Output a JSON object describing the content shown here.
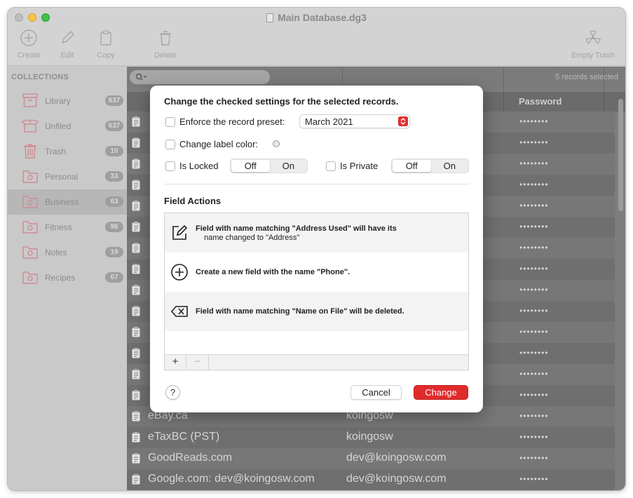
{
  "window": {
    "title": "Main Database.dg3"
  },
  "toolbar": {
    "create": "Create",
    "edit": "Edit",
    "copy": "Copy",
    "delete": "Delete",
    "empty_trash": "Empty Trash"
  },
  "sidebar": {
    "heading": "COLLECTIONS",
    "items": [
      {
        "label": "Library",
        "count": "637",
        "icon": "archive-box-icon"
      },
      {
        "label": "Unfiled",
        "count": "637",
        "icon": "open-box-icon"
      },
      {
        "label": "Trash",
        "count": "10",
        "icon": "trash-icon"
      },
      {
        "label": "Personal",
        "count": "33",
        "icon": "folder-gear-icon"
      },
      {
        "label": "Business",
        "count": "63",
        "icon": "folder-gear-icon"
      },
      {
        "label": "Fitness",
        "count": "96",
        "icon": "folder-gear-icon"
      },
      {
        "label": "Notes",
        "count": "19",
        "icon": "folder-gear-icon"
      },
      {
        "label": "Recipes",
        "count": "67",
        "icon": "folder-gear-icon"
      }
    ]
  },
  "list": {
    "search_placeholder": "",
    "selection_status": "5 records selected",
    "password_header": "Password",
    "rows": [
      {
        "name": "eBay.ca",
        "user": "koingosw"
      },
      {
        "name": "eTaxBC (PST)",
        "user": "koingosw"
      },
      {
        "name": "GoodReads.com",
        "user": "dev@koingosw.com"
      },
      {
        "name": "Google.com: dev@koingosw.com",
        "user": "dev@koingosw.com"
      }
    ],
    "password_mask": "••••••••"
  },
  "dialog": {
    "title": "Change the checked settings for the selected records.",
    "enforce_label": "Enforce the record preset:",
    "preset_value": "March 2021",
    "label_color_label": "Change label color:",
    "locked_label": "Is Locked",
    "private_label": "Is Private",
    "off": "Off",
    "on": "On",
    "field_actions_heading": "Field Actions",
    "actions": [
      {
        "text": "Field with name matching \"Address Used\" will have its",
        "sub": "name changed to \"Address\"",
        "icon": "edit-pencil-icon"
      },
      {
        "text": "Create a new field with the name \"Phone\".",
        "icon": "plus-circle-icon"
      },
      {
        "text": "Field with name matching \"Name on File\" will be deleted.",
        "icon": "delete-backspace-icon"
      }
    ],
    "add": "+",
    "remove": "−",
    "help": "?",
    "cancel": "Cancel",
    "change": "Change"
  },
  "colors": {
    "accent": "#e02b2b"
  }
}
